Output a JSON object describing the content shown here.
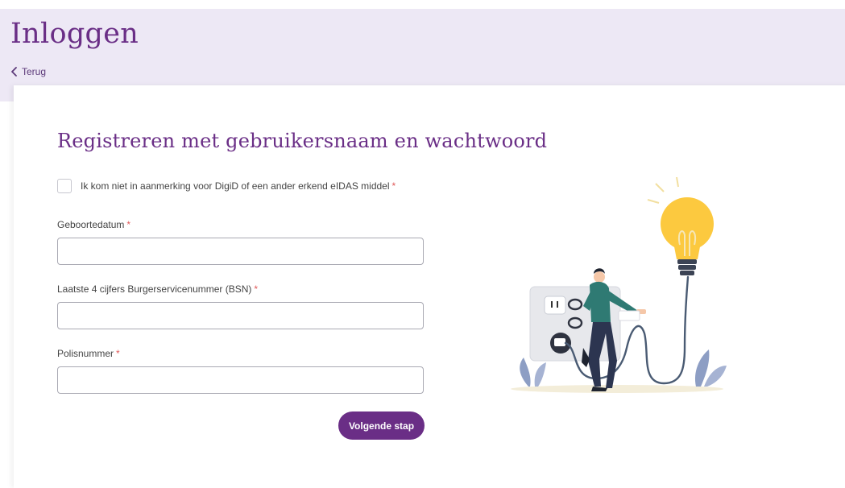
{
  "header": {
    "title": "Inloggen",
    "back_label": "Terug"
  },
  "form": {
    "title": "Registreren met gebruikersnaam en wachtwoord",
    "checkbox_label": "Ik kom niet in aanmerking voor DigiD of een ander erkend eIDAS middel",
    "required_marker": "*",
    "fields": [
      {
        "label": "Geboortedatum",
        "value": ""
      },
      {
        "label": "Laatste 4 cijfers Burgerservicenummer (BSN)",
        "value": ""
      },
      {
        "label": "Polisnummer",
        "value": ""
      }
    ],
    "submit_label": "Volgende stap"
  },
  "illustration": {
    "icon": "person-plugging-cable-lightbulb-illustration"
  },
  "colors": {
    "brand": "#6a2e86",
    "header_bg": "#ede8f5",
    "required": "#e05a5a"
  }
}
